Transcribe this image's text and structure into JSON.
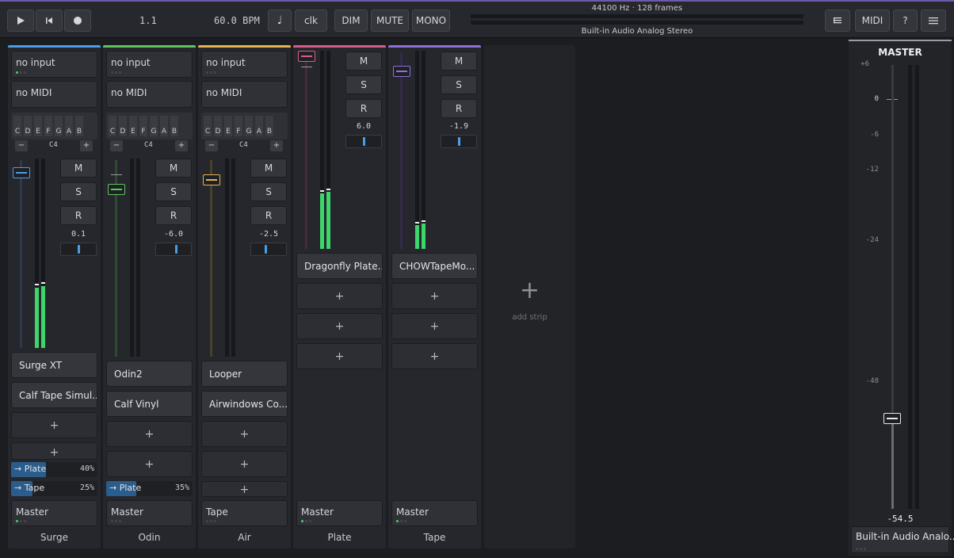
{
  "transport": {
    "play_icon": "play-icon",
    "rewind_icon": "rewind-icon",
    "record_icon": "record-icon",
    "position": "1.1",
    "tempo": "60.0 BPM",
    "metronome_icon": "note-icon",
    "clk_label": "clk",
    "dim_label": "DIM",
    "mute_label": "MUTE",
    "mono_label": "MONO"
  },
  "device": {
    "rate": "44100 Hz · 128 frames",
    "name": "Built-in Audio Analog Stereo"
  },
  "right_buttons": {
    "list_icon": "list-icon",
    "midi_label": "MIDI",
    "help_label": "?",
    "menu_icon": "hamburger-icon"
  },
  "keys": [
    "C",
    "D",
    "E",
    "F",
    "G",
    "A",
    "B"
  ],
  "strips": [
    {
      "name": "Surge",
      "color": "#4a9de8",
      "input": "no input",
      "midi": "no MIDI",
      "octave": "C4",
      "gain": "0.1",
      "plugins": [
        "Surge XT",
        "Calf Tape Simul..."
      ],
      "sends": [
        {
          "name": "→ Plate",
          "pct": "40%"
        },
        {
          "name": "→ Tape",
          "pct": "25%"
        }
      ],
      "output": "Master"
    },
    {
      "name": "Odin",
      "color": "#5ec461",
      "input": "no input",
      "midi": "no MIDI",
      "octave": "C4",
      "gain": "-6.0",
      "plugins": [
        "Odin2",
        "Calf Vinyl"
      ],
      "sends": [
        {
          "name": "→ Plate",
          "pct": "35%"
        }
      ],
      "output": "Master"
    },
    {
      "name": "Air",
      "color": "#e6b34c",
      "input": "no input",
      "midi": "no MIDI",
      "octave": "C4",
      "gain": "-2.5",
      "plugins": [
        "Looper",
        "Airwindows Co..."
      ],
      "sends": [],
      "output": "Tape"
    },
    {
      "name": "Plate",
      "color": "#d85c8a",
      "gain": "6.0",
      "plugins": [
        "Dragonfly Plate..."
      ],
      "output": "Master"
    },
    {
      "name": "Tape",
      "color": "#8c70d8",
      "gain": "-1.9",
      "plugins": [
        "CHOWTapeMo..."
      ],
      "output": "Master"
    }
  ],
  "button_labels": {
    "mute": "M",
    "solo": "S",
    "record": "R",
    "add": "+",
    "key_minus": "−",
    "key_plus": "+"
  },
  "add_strip": {
    "icon": "plus-icon",
    "label": "add strip"
  },
  "master": {
    "title": "MASTER",
    "scale": [
      "+6",
      "0",
      "-6",
      "-12",
      "-24",
      "-48"
    ],
    "gain": "-54.5",
    "output": "Built-in Audio Analo..."
  }
}
